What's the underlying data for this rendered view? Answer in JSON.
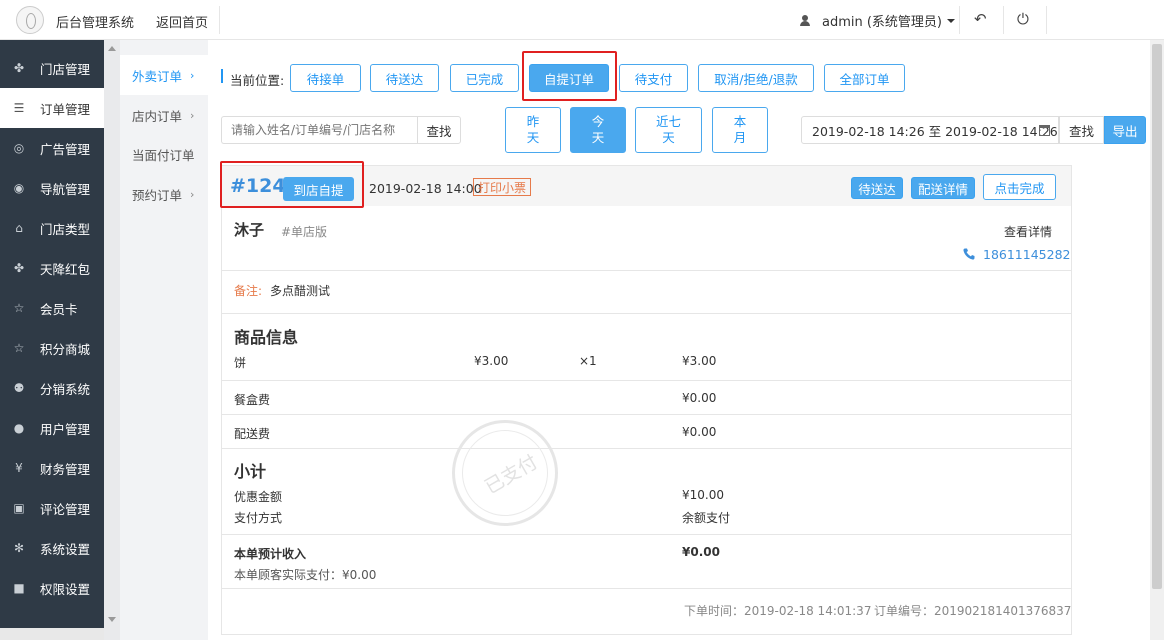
{
  "header": {
    "app_title": "后台管理系统",
    "back_home": "返回首页",
    "user_label": "admin (系统管理员)"
  },
  "sidebar": {
    "items": [
      {
        "label": "门店管理",
        "icon": "store-icon"
      },
      {
        "label": "订单管理",
        "icon": "list-icon"
      },
      {
        "label": "广告管理",
        "icon": "ad-icon"
      },
      {
        "label": "导航管理",
        "icon": "compass-icon"
      },
      {
        "label": "门店类型",
        "icon": "bank-icon"
      },
      {
        "label": "天降红包",
        "icon": "gift-icon"
      },
      {
        "label": "会员卡",
        "icon": "star-icon"
      },
      {
        "label": "积分商城",
        "icon": "star-icon"
      },
      {
        "label": "分销系统",
        "icon": "users-icon"
      },
      {
        "label": "用户管理",
        "icon": "user-icon"
      },
      {
        "label": "财务管理",
        "icon": "yen-icon"
      },
      {
        "label": "评论管理",
        "icon": "comment-icon"
      },
      {
        "label": "系统设置",
        "icon": "gear-icon"
      },
      {
        "label": "权限设置",
        "icon": "lock-icon"
      }
    ]
  },
  "subnav": {
    "items": [
      {
        "label": "外卖订单",
        "chev": "›"
      },
      {
        "label": "店内订单",
        "chev": "›"
      },
      {
        "label": "当面付订单",
        "chev": ""
      },
      {
        "label": "预约订单",
        "chev": "›"
      }
    ]
  },
  "filters": {
    "location_label": "当前位置:",
    "status_tabs": [
      "待接单",
      "待送达",
      "已完成",
      "自提订单",
      "待支付",
      "取消/拒绝/退款",
      "全部订单"
    ],
    "search_placeholder": "请输入姓名/订单编号/门店名称",
    "search_button": "查找",
    "date_buttons": [
      {
        "line1": "昨",
        "line2": "天"
      },
      {
        "line1": "今",
        "line2": "天"
      },
      {
        "line1": "近七",
        "line2": "天"
      },
      {
        "line1": "本",
        "line2": "月"
      }
    ],
    "date_range": "2019-02-18 14:26 至 2019-02-18 14:26",
    "date_search_button": "查找",
    "export_button": "导出"
  },
  "order": {
    "number": "#124",
    "pickup_tag": "到店自提",
    "time": "2019-02-18 14:00",
    "print_label": "打印小票",
    "action_pending": "待送达",
    "action_delivery": "配送详情",
    "action_complete": "点击完成",
    "customer_name": "沐子",
    "store_version": "#单店版",
    "view_details": "查看详情",
    "phone": "18611145282",
    "remark_label": "备注:",
    "remark_value": "多点醋测试",
    "goods_title": "商品信息",
    "goods": [
      {
        "name": "饼",
        "unit_price": "¥3.00",
        "qty": "×1",
        "total": "¥3.00"
      }
    ],
    "box_fee_label": "餐盒费",
    "box_fee_value": "¥0.00",
    "delivery_fee_label": "配送费",
    "delivery_fee_value": "¥0.00",
    "subtotal_title": "小计",
    "discount_label": "优惠金额",
    "discount_value": "¥10.00",
    "pay_method_label": "支付方式",
    "pay_method_value": "余额支付",
    "income_label": "本单预计收入",
    "income_value": "¥0.00",
    "actual_paid": "本单顾客实际支付：¥0.00",
    "placed_time": "下单时间：2019-02-18 14:01:37",
    "order_serial": "订单编号：20190218140137683​7",
    "stamp_text": "已支付"
  }
}
